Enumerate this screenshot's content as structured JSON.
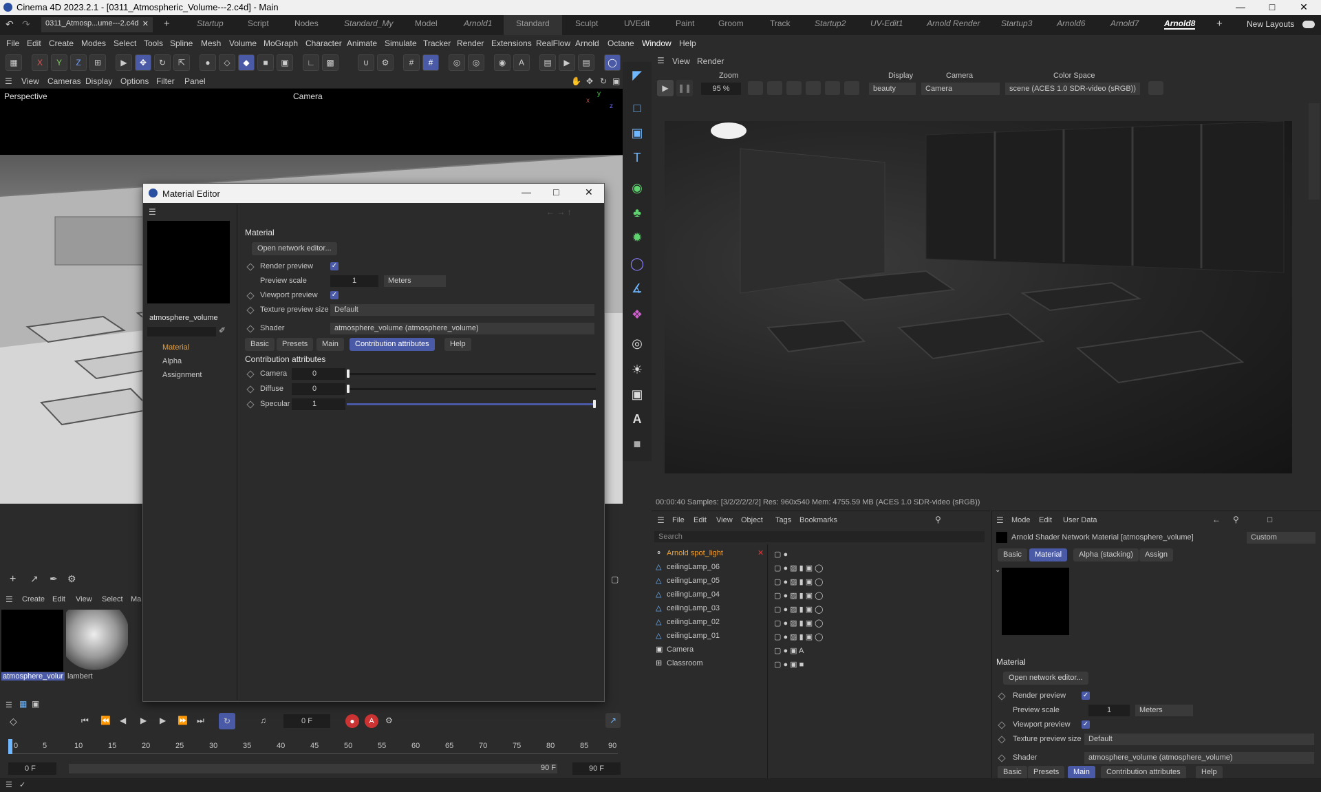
{
  "window": {
    "title": "Cinema 4D 2023.2.1 - [0311_Atmospheric_Volume---2.c4d] - Main"
  },
  "layout_tabs": {
    "doc_tab": "0311_Atmosp...ume---2.c4d",
    "items": [
      "Startup",
      "Script",
      "Nodes",
      "Standard_My",
      "Model",
      "Arnold1",
      "Standard",
      "Sculpt",
      "UVEdit",
      "Paint",
      "Groom",
      "Track",
      "Startup2",
      "UV-Edit1",
      "Arnold Render",
      "Startup3",
      "Arnold6",
      "Arnold7",
      "Arnold8"
    ],
    "new_layouts": "New Layouts"
  },
  "menubar": [
    "File",
    "Edit",
    "Create",
    "Modes",
    "Select",
    "Tools",
    "Spline",
    "Mesh",
    "Volume",
    "MoGraph",
    "Character",
    "Animate",
    "Simulate",
    "Tracker",
    "Render",
    "Extensions",
    "RealFlow",
    "Arnold",
    "Octane",
    "Window",
    "Help"
  ],
  "viewport": {
    "menu": [
      "View",
      "Cameras",
      "Display",
      "Options",
      "Filter",
      "Panel"
    ],
    "label": "Perspective",
    "camera": "Camera"
  },
  "render_view": {
    "menu": [
      "View",
      "Render"
    ],
    "zoom_label": "Zoom",
    "zoom_value": "95 %",
    "display_label": "Display",
    "display_value": "beauty",
    "camera_label": "Camera",
    "camera_value": "Camera",
    "colorspace_label": "Color Space",
    "colorspace_value": "scene (ACES 1.0 SDR-video (sRGB))",
    "status": "00:00:40  Samples: [3/2/2/2/2/2]  Res: 960x540  Mem: 4755.59 MB  (ACES 1.0 SDR-video (sRGB))"
  },
  "material_editor": {
    "title": "Material Editor",
    "material_name": "atmosphere_volume",
    "channels": [
      "Material",
      "Alpha",
      "Assignment"
    ],
    "section_title": "Material",
    "open_network": "Open network editor...",
    "render_preview": "Render preview",
    "preview_scale": "Preview scale",
    "preview_scale_value": "1",
    "preview_scale_unit": "Meters",
    "viewport_preview": "Viewport preview",
    "texture_preview_size": "Texture preview size",
    "texture_preview_value": "Default",
    "shader": "Shader",
    "shader_value": "atmosphere_volume (atmosphere_volume)",
    "tabs": [
      "Basic",
      "Presets",
      "Main",
      "Contribution attributes",
      "Help"
    ],
    "contrib_title": "Contribution attributes",
    "contrib": [
      {
        "label": "Camera",
        "value": "0",
        "level": 0
      },
      {
        "label": "Diffuse",
        "value": "0",
        "level": 0
      },
      {
        "label": "Specular",
        "value": "1",
        "level": 1
      }
    ]
  },
  "object_manager": {
    "menu": [
      "File",
      "Edit",
      "View",
      "Object",
      "Tags",
      "Bookmarks"
    ],
    "search": "Search",
    "objects": [
      "Arnold spot_light",
      "ceilingLamp_06",
      "ceilingLamp_05",
      "ceilingLamp_04",
      "ceilingLamp_03",
      "ceilingLamp_02",
      "ceilingLamp_01",
      "Camera",
      "Classroom"
    ]
  },
  "attribute_manager": {
    "menu": [
      "Mode",
      "Edit",
      "User Data"
    ],
    "header": "Arnold Shader Network Material [atmosphere_volume]",
    "mode": "Custom",
    "tabs": [
      "Basic",
      "Material",
      "Alpha (stacking)",
      "Assign"
    ],
    "section_title": "Material",
    "open_network": "Open network editor...",
    "render_preview": "Render preview",
    "preview_scale": "Preview scale",
    "preview_scale_value": "1",
    "preview_scale_unit": "Meters",
    "viewport_preview": "Viewport preview",
    "texture_preview_size": "Texture preview size",
    "texture_preview_value": "Default",
    "shader": "Shader",
    "shader_value": "atmosphere_volume (atmosphere_volume)",
    "bottom_tabs": [
      "Basic",
      "Presets",
      "Main",
      "Contribution attributes",
      "Help"
    ]
  },
  "material_manager": {
    "menu": [
      "Create",
      "Edit",
      "View",
      "Select",
      "Ma"
    ],
    "materials": [
      "atmosphere_volur",
      "lambert"
    ]
  },
  "timeline": {
    "frame": "0 F",
    "ticks": [
      "0",
      "5",
      "10",
      "15",
      "20",
      "25",
      "30",
      "35",
      "40",
      "45",
      "50",
      "55",
      "60",
      "65",
      "70",
      "75",
      "80",
      "85",
      "90"
    ],
    "start1": "0 F",
    "start2": "0 F",
    "end1": "90 F",
    "end2": "90 F"
  },
  "colors": {
    "accent": "#4b5aa6",
    "selected_text": "#f0a030",
    "red": "#e23a3a"
  }
}
